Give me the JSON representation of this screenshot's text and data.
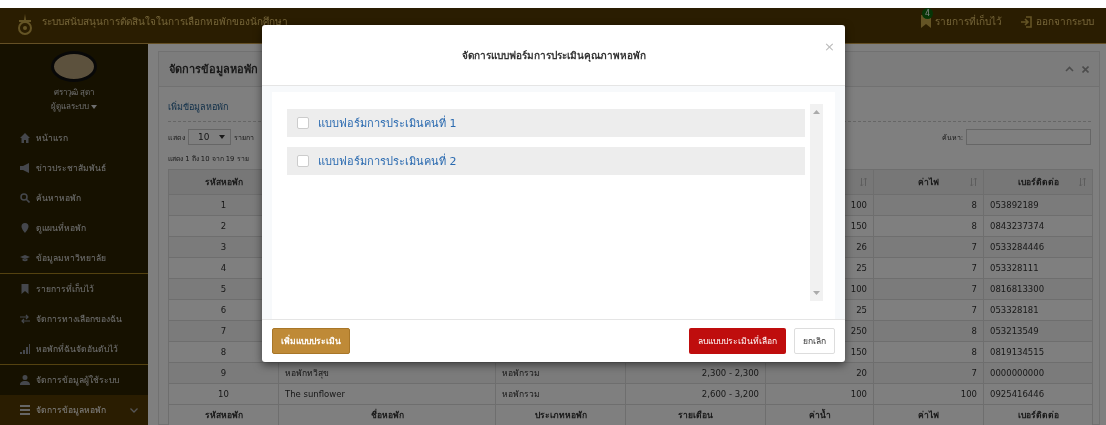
{
  "top_bar": {
    "title": "ระบบสนับสนุนการตัดสินใจในการเลือกหอพักของนักศึกษา",
    "saved_count": "4",
    "saved_label": "รายการที่เก็บไว้",
    "logout_label": "ออกจากระบบ"
  },
  "sidebar": {
    "user_name": "ศราวุฒิ สุดา",
    "role": "ผู้ดูแลระบบ",
    "groups": [
      [
        {
          "label": "หน้าแรก",
          "selected": false
        },
        {
          "label": "ข่าวประชาสัมพันธ์",
          "selected": false
        },
        {
          "label": "ค้นหาหอพัก",
          "selected": false
        },
        {
          "label": "ดูแผนที่หอพัก",
          "selected": false
        },
        {
          "label": "ข้อมูลมหาวิทยาลัย",
          "selected": false
        }
      ],
      [
        {
          "label": "รายการที่เก็บไว้",
          "selected": false
        },
        {
          "label": "จัดการทางเลือกของฉัน",
          "selected": false
        },
        {
          "label": "หอพักที่ฉันจัดอันดับไว้",
          "selected": false
        }
      ],
      [
        {
          "label": "จัดการข้อมูลผู้ใช้ระบบ",
          "selected": false
        },
        {
          "label": "จัดการข้อมูลหอพัก",
          "selected": true
        }
      ]
    ]
  },
  "panel": {
    "title": "จัดการข้อมูลหอพัก",
    "add_link": "เพิ่มข้อมูลหอพัก",
    "show_label": "แสดง",
    "page_size": "10",
    "entries_label": "รายกา",
    "info": "แสดง 1 ถึง 10 จาก 19 ราย",
    "search_label": "ค้นหา:",
    "table": {
      "columns": [
        "รหัสหอพัก",
        null,
        null,
        null,
        null,
        "ค่าไฟ",
        "เบอร์ติดต่อ"
      ],
      "rows": [
        {
          "id": "1",
          "water": "100",
          "electricity": "8",
          "phone": "053892189"
        },
        {
          "id": "2",
          "water": "150",
          "electricity": "8",
          "phone": "0843237374"
        },
        {
          "id": "3",
          "water": "26",
          "electricity": "7",
          "phone": "0533284446"
        },
        {
          "id": "4",
          "water": "25",
          "electricity": "7",
          "phone": "053328111"
        },
        {
          "id": "5",
          "water": "100",
          "electricity": "7",
          "phone": "0816813300"
        },
        {
          "id": "6",
          "water": "25",
          "electricity": "7",
          "phone": "053328181"
        },
        {
          "id": "7",
          "water": "250",
          "electricity": "8",
          "phone": "053213549"
        },
        {
          "id": "8",
          "water": "150",
          "electricity": "8",
          "phone": "0819134515"
        },
        {
          "id": "9",
          "name": "หอพักทวิสุข",
          "type": "หอพักรวม",
          "monthly": "2,300 - 2,300",
          "water": "20",
          "electricity": "7",
          "phone": "0000000000"
        },
        {
          "id": "10",
          "name": "The sunflower",
          "type": "หอพักรวม",
          "monthly": "2,600 - 3,200",
          "water": "100",
          "electricity": "100",
          "phone": "0925416446"
        }
      ],
      "footer_columns": [
        "รหัสหอพัก",
        "ชื่อหอพัก",
        "ประเภทหอพัก",
        "รายเดือน",
        "ค่าน้ำ",
        "ค่าไฟ",
        "เบอร์ติดต่อ"
      ]
    }
  },
  "modal": {
    "title": "จัดการแบบฟอร์มการประเมินคุณภาพหอพัก",
    "close": "×",
    "forms": [
      {
        "label": "แบบฟอร์มการประเมินคนที่ 1",
        "checked": false
      },
      {
        "label": "แบบฟอร์มการประเมินคนที่ 2",
        "checked": false
      }
    ],
    "add_button": "เพิ่มแบบประเมิน",
    "delete_button": "ลบแบบประเมินที่เลือก",
    "cancel_button": "ยกเลิก"
  }
}
